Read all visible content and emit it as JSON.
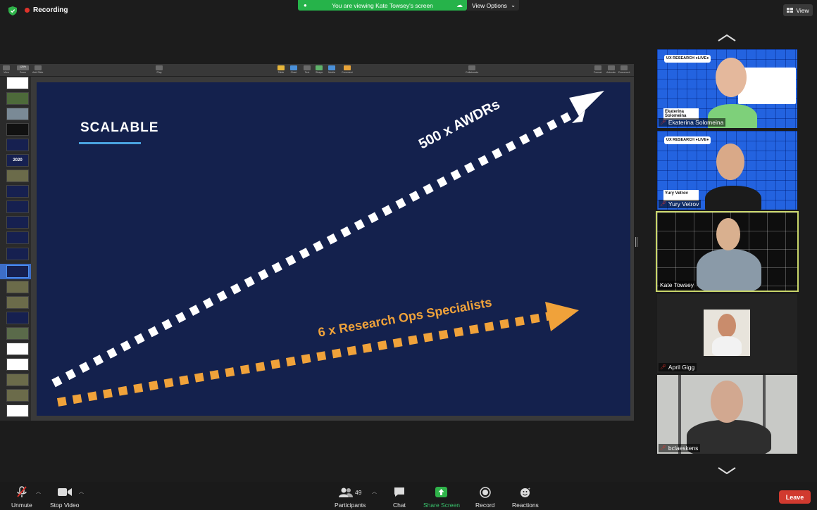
{
  "topbar": {
    "recording_label": "Recording",
    "share_banner": "You are viewing Kate Towsey's screen",
    "view_options_label": "View Options",
    "view_label": "View"
  },
  "keynote": {
    "toolbar": [
      {
        "label": "View",
        "icon": "view-icon"
      },
      {
        "label": "Zoom",
        "icon": "zoom-icon"
      },
      {
        "label": "Add Slide",
        "icon": "add-slide-icon"
      },
      {
        "label": "Play",
        "icon": "play-icon"
      },
      {
        "label": "Table",
        "icon": "table-icon"
      },
      {
        "label": "Chart",
        "icon": "chart-icon"
      },
      {
        "label": "Text",
        "icon": "text-icon"
      },
      {
        "label": "Shape",
        "icon": "shape-icon"
      },
      {
        "label": "Media",
        "icon": "media-icon"
      },
      {
        "label": "Comment",
        "icon": "comment-icon"
      },
      {
        "label": "Collaborate",
        "icon": "collaborate-icon"
      },
      {
        "label": "Format",
        "icon": "format-icon"
      },
      {
        "label": "Animate",
        "icon": "animate-icon"
      },
      {
        "label": "Document",
        "icon": "document-icon"
      }
    ],
    "zoom": "125%",
    "thumb_year": "2020"
  },
  "slide": {
    "title": "SCALABLE",
    "arrow_top_label": "500 x AWDRs",
    "arrow_bottom_label": "6 x Research Ops Specialists",
    "colors": {
      "background": "#14214d",
      "accent_white": "#ffffff",
      "accent_orange": "#f0a23a",
      "underline": "#4aa3df"
    }
  },
  "participants": [
    {
      "name": "Ekaterina Solomeina",
      "muted": true,
      "background_label": "UX RESEARCH ●LIVE●",
      "overlay_name": "Ekaterina Solomeina"
    },
    {
      "name": "Yury Vetrov",
      "muted": true,
      "background_label": "UX RESEARCH ●LIVE●",
      "overlay_name": "Yury Vetrov"
    },
    {
      "name": "Kate Towsey",
      "muted": false,
      "active": true
    },
    {
      "name": "April Gigg",
      "muted": true
    },
    {
      "name": "bclaeskens",
      "muted": true
    }
  ],
  "bottombar": {
    "unmute": "Unmute",
    "stop_video": "Stop Video",
    "participants": "Participants",
    "participant_count": "49",
    "chat": "Chat",
    "share_screen": "Share Screen",
    "record": "Record",
    "reactions": "Reactions",
    "leave": "Leave"
  }
}
